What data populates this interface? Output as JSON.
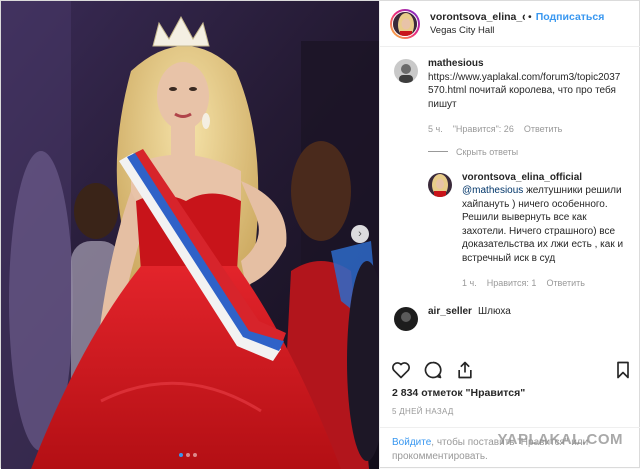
{
  "header": {
    "username": "vorontsova_elina_c",
    "dot": "•",
    "follow_label": "Подписаться",
    "location": "Vegas City Hall"
  },
  "comments": [
    {
      "user": "mathesious",
      "text": "https://www.yaplakal.com/forum3/topic2037570.html почитай королева, что про тебя пишут",
      "time": "5 ч.",
      "likes": "\"Нравится\": 26",
      "reply_label": "Ответить",
      "hide_replies": "Скрыть ответы"
    }
  ],
  "reply": {
    "user": "vorontsova_elina_official",
    "mention": "@mathesious",
    "text": " желтушники решили хайпануть ) ничего особенного. Решили вывернуть все как захотели. Ничего страшного) все доказательства их лжи есть , как и встречный иск в суд",
    "time": "1 ч.",
    "likes": "Нравится: 1",
    "reply_label": "Ответить"
  },
  "next_comment": {
    "user": "air_seller",
    "text": "Шлюха"
  },
  "likes_text": "2 834 отметок \"Нравится\"",
  "date_text": "5 ДНЕЙ НАЗАД",
  "login": {
    "link": "Войдите",
    "text": ", чтобы поставить \"Нравится\" или прокомментировать."
  },
  "watermark": "YAPLAKAL.COM",
  "icons": [
    "heart-icon",
    "comment-icon",
    "share-icon",
    "bookmark-icon",
    "chevron-right-icon"
  ],
  "colors": {
    "accent": "#3897f0",
    "dress": "#d6191e",
    "backdrop": "#2a1f3d"
  },
  "carousel": {
    "slides": 3,
    "active_index": 0
  }
}
